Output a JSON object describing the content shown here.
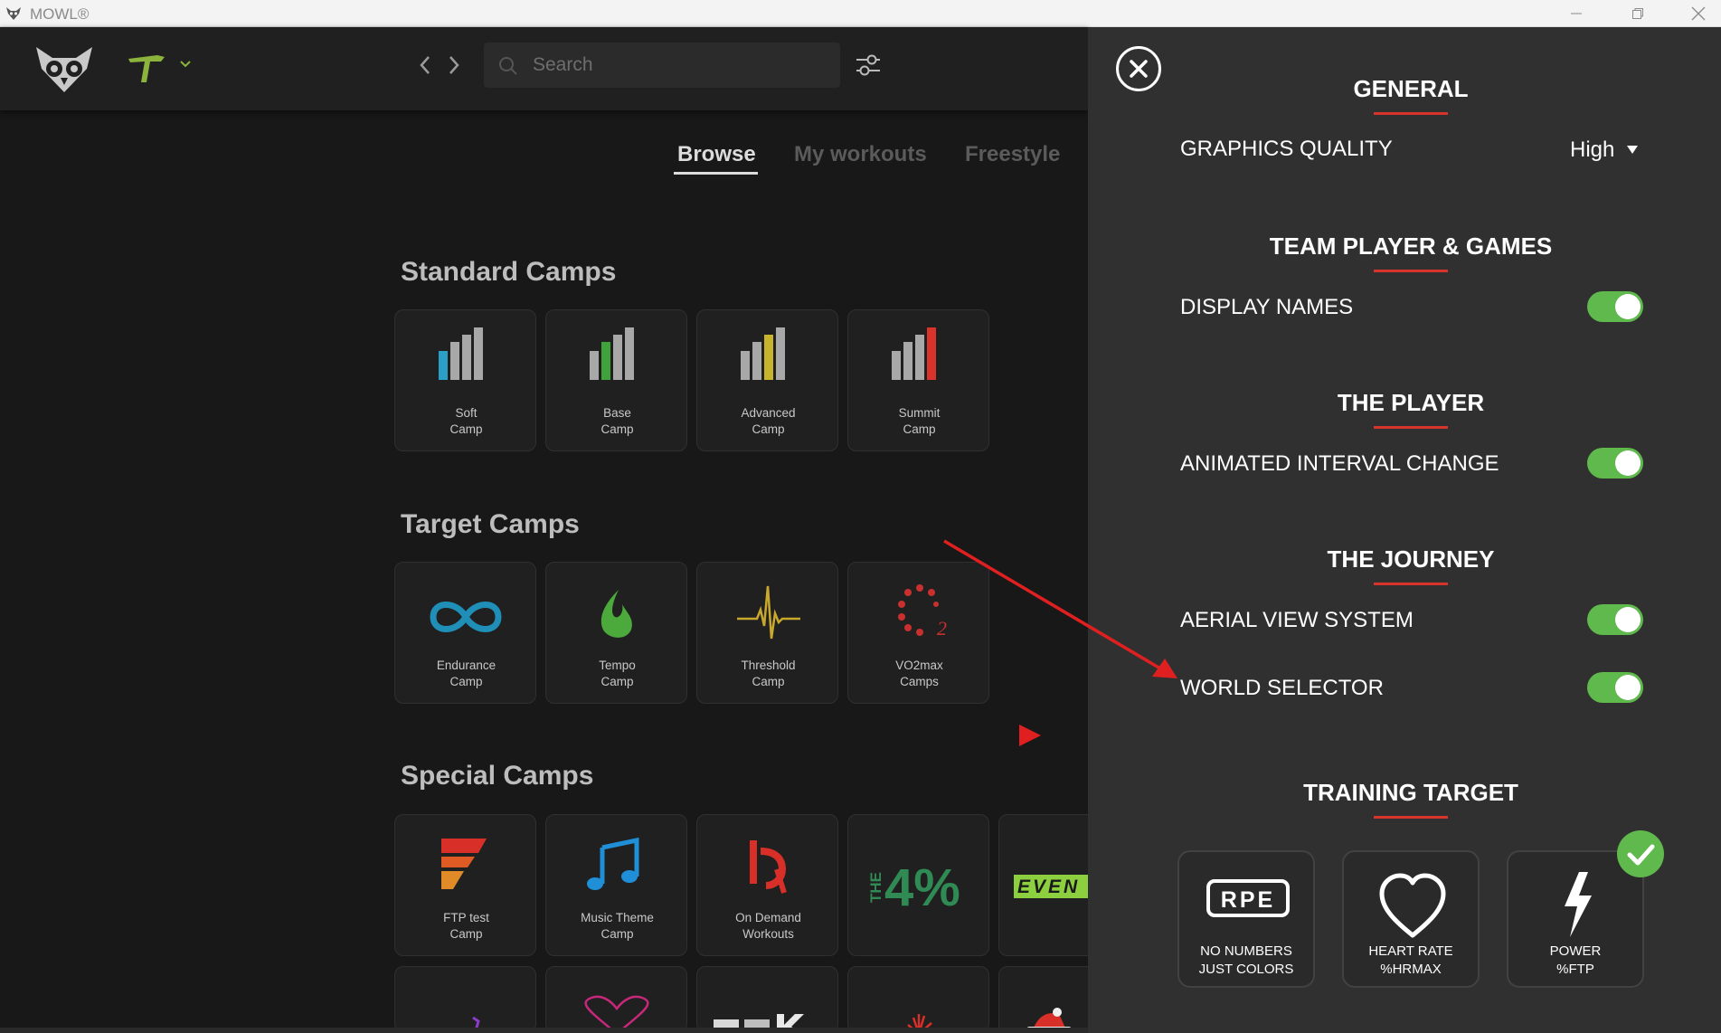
{
  "window": {
    "title": "MOWL®"
  },
  "search": {
    "placeholder": "Search"
  },
  "tabs": [
    {
      "label": "Browse",
      "active": true
    },
    {
      "label": "My workouts",
      "active": false
    },
    {
      "label": "Freestyle",
      "active": false
    }
  ],
  "sections": {
    "standard": {
      "title": "Standard Camps",
      "cards": [
        {
          "line1": "Soft",
          "line2": "Camp"
        },
        {
          "line1": "Base",
          "line2": "Camp"
        },
        {
          "line1": "Advanced",
          "line2": "Camp"
        },
        {
          "line1": "Summit",
          "line2": "Camp"
        }
      ]
    },
    "target": {
      "title": "Target Camps",
      "cards": [
        {
          "line1": "Endurance",
          "line2": "Camp"
        },
        {
          "line1": "Tempo",
          "line2": "Camp"
        },
        {
          "line1": "Threshold",
          "line2": "Camp"
        },
        {
          "line1": "VO2max",
          "line2": "Camps"
        }
      ]
    },
    "special": {
      "title": "Special Camps",
      "cards": [
        {
          "line1": "FTP test",
          "line2": "Camp"
        },
        {
          "line1": "Music Theme",
          "line2": "Camp"
        },
        {
          "line1": "On Demand",
          "line2": "Workouts"
        },
        {
          "line1": "THE 4%",
          "line2": ""
        },
        {
          "line1": "EVEN",
          "line2": ""
        }
      ]
    }
  },
  "settings": {
    "general": {
      "heading": "GENERAL",
      "graphics_quality_label": "GRAPHICS QUALITY",
      "graphics_quality_value": "High"
    },
    "team": {
      "heading": "TEAM PLAYER & GAMES",
      "display_names_label": "DISPLAY NAMES",
      "display_names_on": true
    },
    "player": {
      "heading": "THE PLAYER",
      "animated_interval_label": "ANIMATED INTERVAL CHANGE",
      "animated_interval_on": true
    },
    "journey": {
      "heading": "THE JOURNEY",
      "aerial_view_label": "AERIAL VIEW SYSTEM",
      "aerial_view_on": true,
      "world_selector_label": "WORLD SELECTOR",
      "world_selector_on": true
    },
    "training": {
      "heading": "TRAINING TARGET",
      "options": [
        {
          "line1": "NO NUMBERS",
          "line2": "JUST COLORS",
          "selected": false
        },
        {
          "line1": "HEART RATE",
          "line2": "%HRMAX",
          "selected": false
        },
        {
          "line1": "POWER",
          "line2": "%FTP",
          "selected": true
        }
      ]
    }
  },
  "colors": {
    "accent_red": "#d8342c",
    "toggle_green": "#5fb94d",
    "panel_bg": "#303030"
  }
}
